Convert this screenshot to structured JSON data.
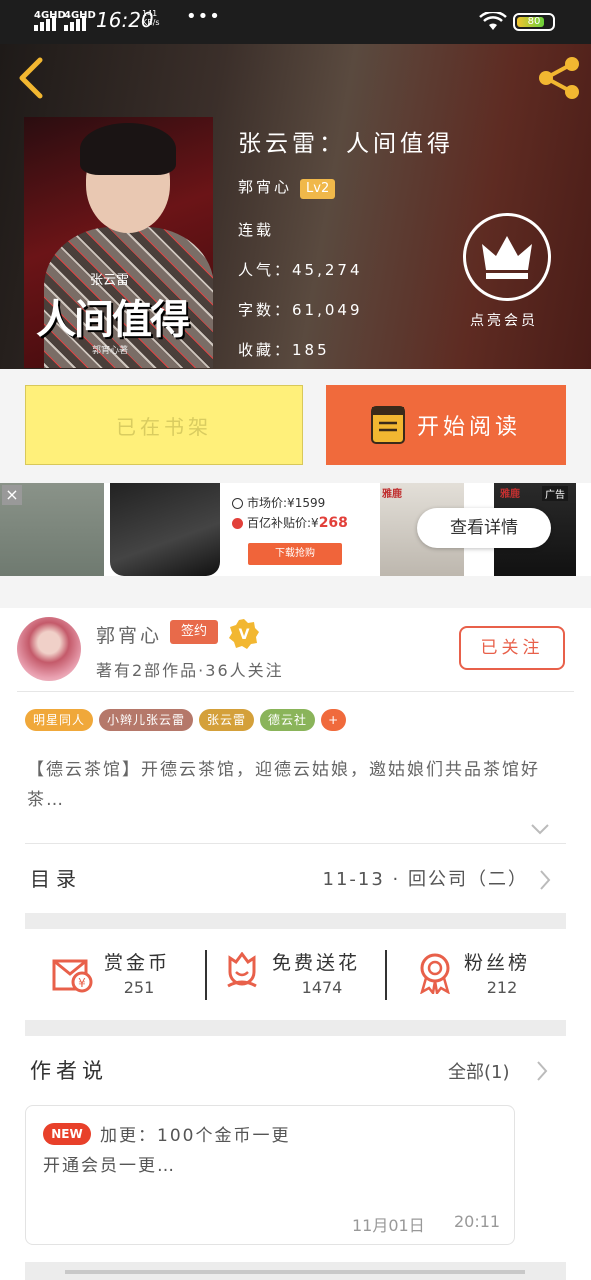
{
  "status": {
    "net1": "4GHD",
    "net2": "4GHD",
    "time": "16:20",
    "speed_top": "141",
    "speed_unit": "KB/s",
    "dots": "•••",
    "battery": "80",
    "battery_level": 0.8
  },
  "header": {
    "back": "‹",
    "book_title": "张云雷：人间值得",
    "author": "郭宵心",
    "level": "Lv2",
    "status": "连载",
    "popularity": "人气：45,274",
    "words": "字数：61,049",
    "collections": "收藏：185",
    "vip_label": "点亮会员",
    "cover": {
      "title": "人间值得",
      "subtitle": "张云雷",
      "byline": "郭宵心著"
    }
  },
  "actions": {
    "shelf": "已在书架",
    "read": "开始阅读"
  },
  "ad": {
    "market_label": "市场价:¥",
    "market_price": "1599",
    "subsidy_label": "百亿补贴价:¥",
    "subsidy_price": "268",
    "download": "下载抢购",
    "details": "查看详情",
    "brand": "雅鹿",
    "ad_label": "广告"
  },
  "author": {
    "name": "郭宵心",
    "badge": "签约",
    "v": "V",
    "stats": "著有2部作品·36人关注",
    "follow": "已关注",
    "tags": [
      {
        "label": "明星同人",
        "color": "#f0a83a"
      },
      {
        "label": "小辫儿张云雷",
        "color": "#b5786a"
      },
      {
        "label": "张云雷",
        "color": "#d4a03a"
      },
      {
        "label": "德云社",
        "color": "#8ab45a"
      }
    ],
    "tag_more": "+",
    "intro": "【德云茶馆】开德云茶馆，迎德云姑娘，邀姑娘们共品茶馆好茶…"
  },
  "catalog": {
    "label": "目录",
    "latest": "11-13 · 回公司（二）"
  },
  "gifts": [
    {
      "label": "赏金币",
      "count": "251"
    },
    {
      "label": "免费送花",
      "count": "1474"
    },
    {
      "label": "粉丝榜",
      "count": "212"
    }
  ],
  "notes": {
    "label": "作者说",
    "all": "全部(1)",
    "new_badge": "NEW",
    "line1": "加更：100个金币一更",
    "line2": "开通会员一更…",
    "date": "11月01日",
    "time": "20:11"
  },
  "colors": {
    "accent": "#f06a3c",
    "shelf_bg": "#fff07a",
    "level_bg": "#f0b84a",
    "vip_gold": "#f2b731",
    "price_red": "#e2403a"
  }
}
